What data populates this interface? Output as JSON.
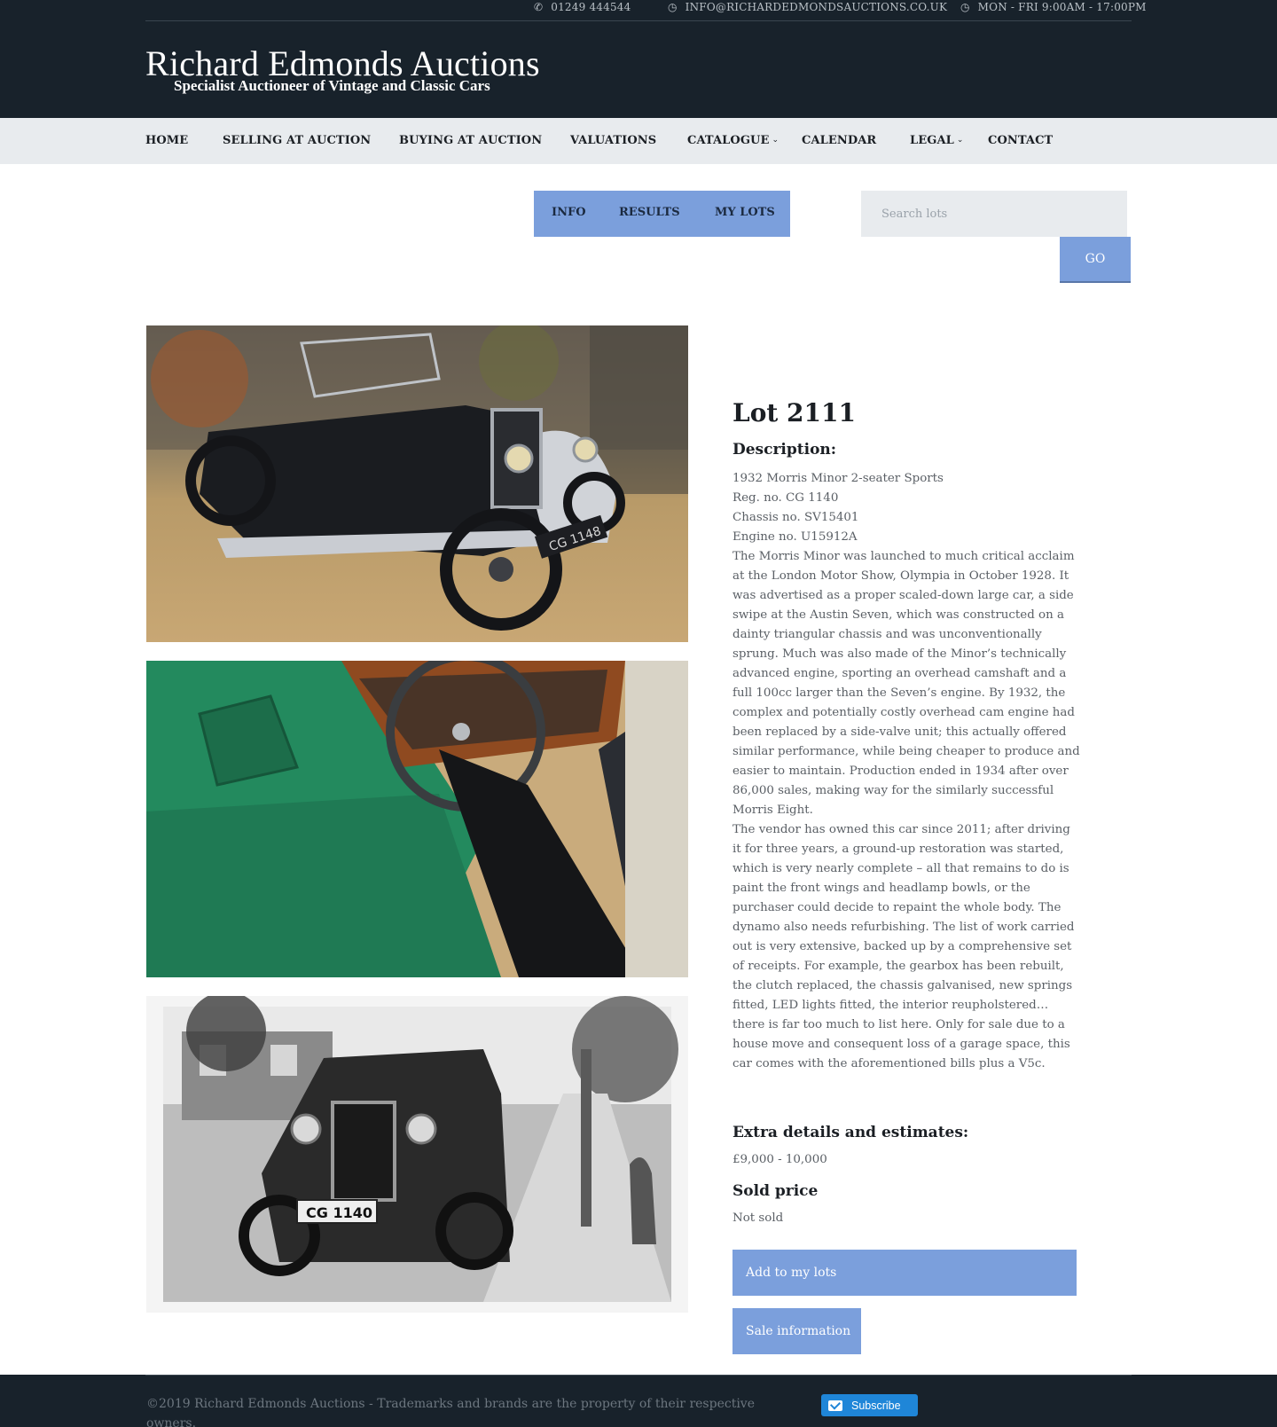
{
  "header": {
    "phone": "01249 444544",
    "email": "INFO@RICHARDEDMONDSAUCTIONS.CO.UK",
    "hours": "MON - FRI 9:00AM - 17:00PM",
    "brand_title": "Richard Edmonds Auctions",
    "brand_subtitle": "Specialist Auctioneer of Vintage and Classic Cars"
  },
  "nav": {
    "home": "HOME",
    "selling": "SELLING AT AUCTION",
    "buying": "BUYING AT AUCTION",
    "valuations": "VALUATIONS",
    "catalogue": "CATALOGUE",
    "calendar": "CALENDAR",
    "legal": "LEGAL",
    "contact": "CONTACT",
    "chevron": "⌄"
  },
  "subnav": {
    "info": "INFO",
    "results": "RESULTS",
    "my_lots": "MY LOTS"
  },
  "search": {
    "placeholder": "Search lots",
    "go": "GO"
  },
  "lot": {
    "title": "Lot 2111",
    "description_heading": "Description:",
    "lines": [
      "1932 Morris Minor 2-seater Sports",
      "Reg. no. CG 1140",
      "Chassis no. SV15401",
      "Engine no. U15912A"
    ],
    "paragraph1": "The Morris Minor was launched to much critical acclaim at the London Motor Show, Olympia in October 1928. It was advertised as a proper scaled-down large car, a side swipe at the Austin Seven, which was constructed on a dainty triangular chassis and was unconventionally sprung. Much was also made of the Minor’s technically advanced engine, sporting an overhead camshaft and a full 100cc larger than the Seven’s engine. By 1932, the complex and potentially costly overhead cam engine had been replaced by a side-valve unit; this actually offered similar performance, while being cheaper to produce and easier to maintain. Production ended in 1934 after over 86,000 sales, making way for the similarly successful Morris Eight.",
    "paragraph2": "The vendor has owned this car since 2011; after driving it for three years, a ground-up restoration was started, which is very nearly complete – all that remains to do is paint the front wings and headlamp bowls, or the purchaser could decide to repaint the whole body. The dynamo also needs refurbishing. The list of work carried out is very extensive, backed up by a comprehensive set of receipts. For example, the gearbox has been rebuilt, the clutch replaced, the chassis galvanised, new springs fitted, LED lights fitted, the interior reupholstered… there is far too much to list here. Only for sale due to a house move and consequent loss of a garage space, this car comes with the aforementioned bills plus a V5c.",
    "extra_heading": "Extra details and estimates:",
    "estimate": "£9,000 - 10,000",
    "sold_heading": "Sold price",
    "sold_value": "Not sold",
    "add_button": "Add to my lots",
    "sale_button": "Sale information"
  },
  "photo_plates": {
    "rear_plate": "CG 1148",
    "front_plate": "CG 1140"
  },
  "footer": {
    "copyright": "©2019 Richard Edmonds Auctions - Trademarks and brands are the property of their respective owners.",
    "subscribe": "Subscribe"
  },
  "colors": {
    "header_bg": "#18222b",
    "nav_bg": "#e8ebee",
    "accent": "#7b9fdc",
    "subscribe": "#1f86d8"
  },
  "icons": [
    "phone-icon",
    "clock-icon",
    "mail-icon",
    "chevron-down-icon"
  ]
}
